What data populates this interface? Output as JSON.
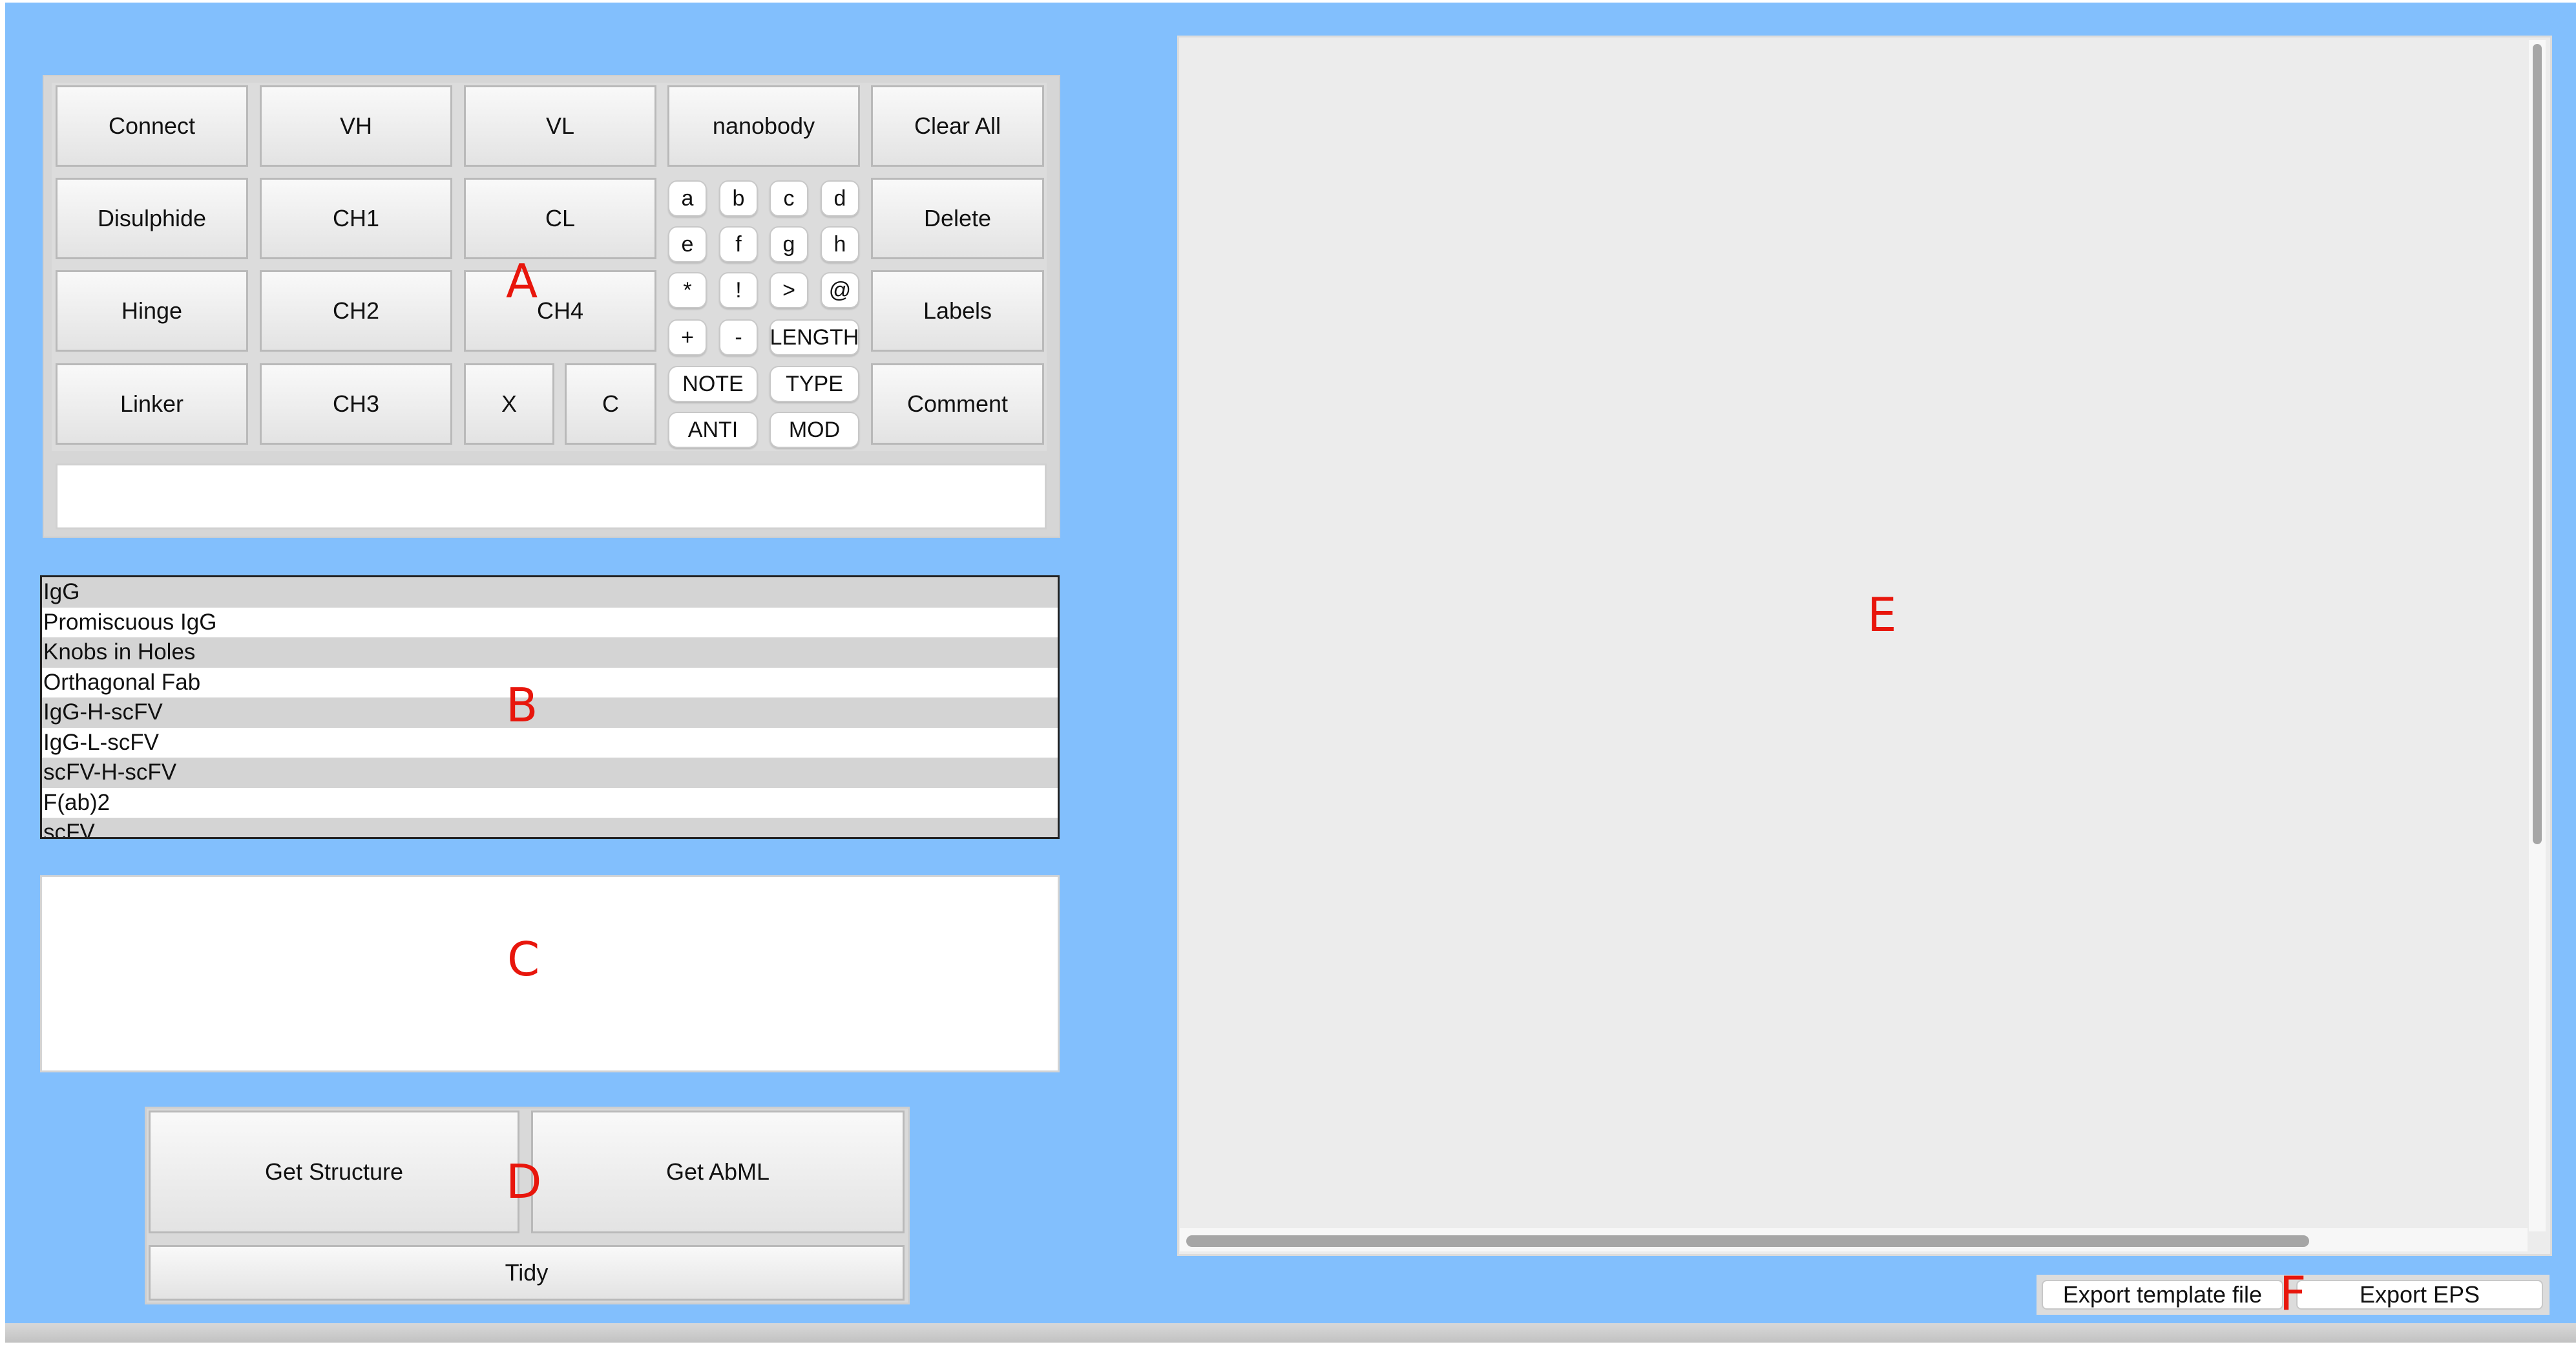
{
  "toolbar_a": {
    "connect": "Connect",
    "vh": "VH",
    "vl": "VL",
    "nanobody": "nanobody",
    "clear_all": "Clear All",
    "disulphide": "Disulphide",
    "ch1": "CH1",
    "cl": "CL",
    "delete": "Delete",
    "hinge": "Hinge",
    "ch2": "CH2",
    "ch4": "CH4",
    "labels": "Labels",
    "linker": "Linker",
    "ch3": "CH3",
    "x": "X",
    "c": "C",
    "comment": "Comment",
    "small_keys": [
      "a",
      "b",
      "c",
      "d",
      "e",
      "f",
      "g",
      "h",
      "*",
      "!",
      ">",
      "@",
      "+",
      "-"
    ],
    "length": "LENGTH",
    "note": "NOTE",
    "type": "TYPE",
    "anti": "ANTI",
    "mod": "MOD",
    "sequence_input_value": ""
  },
  "template_list": {
    "items": [
      "IgG",
      "Promiscuous IgG",
      "Knobs in Holes",
      "Orthagonal Fab",
      "IgG-H-scFV",
      "IgG-L-scFV",
      "scFV-H-scFV",
      "F(ab)2",
      "scFV"
    ]
  },
  "output_text": "",
  "actions_d": {
    "get_structure": "Get Structure",
    "get_abml": "Get AbML",
    "tidy": "Tidy"
  },
  "export_f": {
    "export_template": "Export template file",
    "export_eps": "Export EPS"
  },
  "markers": {
    "a": "A",
    "b": "B",
    "c": "C",
    "d": "D",
    "e": "E",
    "f": "F"
  },
  "colors": {
    "background": "#82bffd",
    "marker": "#e8160c",
    "list_alt_row": "#d4d4d4",
    "canvas": "#ececec"
  }
}
